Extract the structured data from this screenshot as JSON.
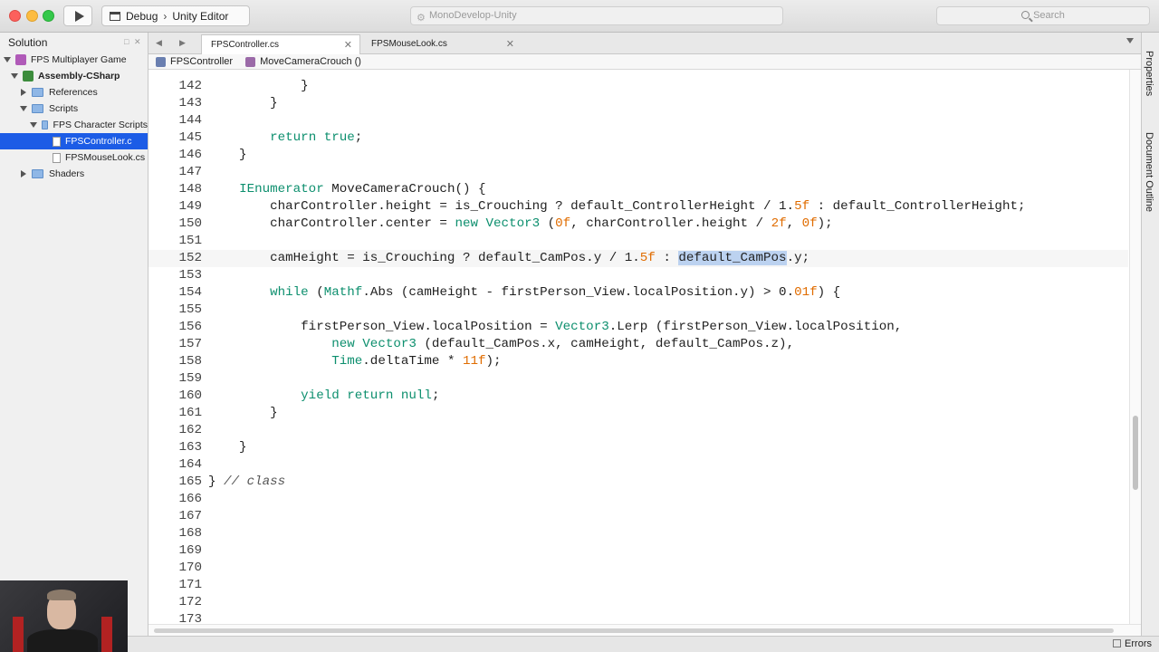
{
  "window": {
    "config": "Debug",
    "target": "Unity Editor",
    "status": "MonoDevelop-Unity",
    "search_placeholder": "Search"
  },
  "solution": {
    "title": "Solution",
    "tree": [
      {
        "label": "FPS Multiplayer Game",
        "kind": "solution"
      },
      {
        "label": "Assembly-CSharp",
        "kind": "assembly"
      },
      {
        "label": "References",
        "kind": "folder"
      },
      {
        "label": "Scripts",
        "kind": "folder"
      },
      {
        "label": "FPS Character Scripts",
        "kind": "folder"
      },
      {
        "label": "FPSController.c",
        "kind": "file",
        "selected": true
      },
      {
        "label": "FPSMouseLook.cs",
        "kind": "file"
      },
      {
        "label": "Shaders",
        "kind": "folder"
      }
    ]
  },
  "tabs": [
    {
      "label": "FPSController.cs",
      "active": true
    },
    {
      "label": "FPSMouseLook.cs",
      "active": false
    }
  ],
  "breadcrumb": {
    "class_name": "FPSController",
    "method_name": "MoveCameraCrouch ()"
  },
  "editor": {
    "current_line": 152,
    "lines": [
      {
        "n": "142",
        "code": "            }"
      },
      {
        "n": "143",
        "code": "        }"
      },
      {
        "n": "144",
        "code": ""
      },
      {
        "n": "145",
        "code": "        return true;"
      },
      {
        "n": "146",
        "code": "    }"
      },
      {
        "n": "147",
        "code": ""
      },
      {
        "n": "148",
        "code": "    IEnumerator MoveCameraCrouch() {"
      },
      {
        "n": "149",
        "code": "        charController.height = is_Crouching ? default_ControllerHeight / 1.5f : default_ControllerHeight;"
      },
      {
        "n": "150",
        "code": "        charController.center = new Vector3 (0f, charController.height / 2f, 0f);"
      },
      {
        "n": "151",
        "code": ""
      },
      {
        "n": "152",
        "code": "        camHeight = is_Crouching ? default_CamPos.y / 1.5f : default_CamPos.y;"
      },
      {
        "n": "153",
        "code": ""
      },
      {
        "n": "154",
        "code": "        while (Mathf.Abs (camHeight - firstPerson_View.localPosition.y) > 0.01f) {"
      },
      {
        "n": "155",
        "code": ""
      },
      {
        "n": "156",
        "code": "            firstPerson_View.localPosition = Vector3.Lerp (firstPerson_View.localPosition,"
      },
      {
        "n": "157",
        "code": "                new Vector3 (default_CamPos.x, camHeight, default_CamPos.z),"
      },
      {
        "n": "158",
        "code": "                Time.deltaTime * 11f);"
      },
      {
        "n": "159",
        "code": ""
      },
      {
        "n": "160",
        "code": "            yield return null;"
      },
      {
        "n": "161",
        "code": "        }"
      },
      {
        "n": "162",
        "code": ""
      },
      {
        "n": "163",
        "code": "    }"
      },
      {
        "n": "164",
        "code": ""
      },
      {
        "n": "165",
        "code": "} // class"
      },
      {
        "n": "166",
        "code": ""
      },
      {
        "n": "167",
        "code": ""
      },
      {
        "n": "168",
        "code": ""
      },
      {
        "n": "169",
        "code": ""
      },
      {
        "n": "170",
        "code": ""
      },
      {
        "n": "171",
        "code": ""
      },
      {
        "n": "172",
        "code": ""
      },
      {
        "n": "173",
        "code": ""
      }
    ],
    "selection": "default_CamPos"
  },
  "right_dock": {
    "tabs": [
      "Properties",
      "Document Outline"
    ]
  },
  "statusbar": {
    "errors_label": "Errors"
  },
  "colors": {
    "keyword": "#0d8f6e",
    "number": "#e06c00",
    "selection": "#bcd2f0",
    "tree_selection": "#1c5ce6"
  }
}
